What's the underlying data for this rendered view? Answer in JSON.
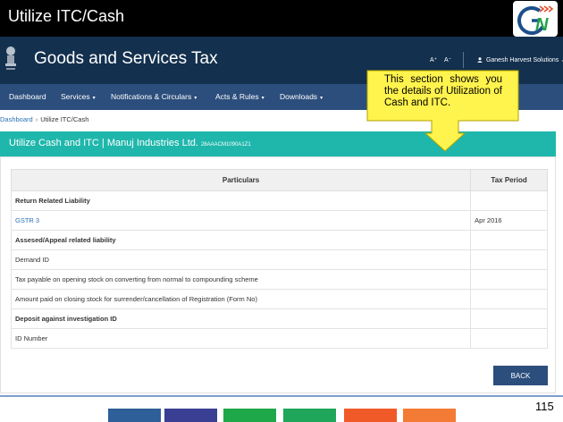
{
  "slide": {
    "title": "Utilize ITC/Cash",
    "logo_text": "GN",
    "page_number": "115"
  },
  "header": {
    "title": "Goods and Services Tax",
    "font_increase": "A⁺",
    "font_decrease": "A⁻",
    "user_name": "Ganesh Harvest Solutions",
    "user_caret": "⌄"
  },
  "nav": {
    "items": [
      {
        "label": "Dashboard",
        "has_caret": false
      },
      {
        "label": "Services",
        "has_caret": true
      },
      {
        "label": "Notifications & Circulars",
        "has_caret": true
      },
      {
        "label": "Acts & Rules",
        "has_caret": true
      },
      {
        "label": "Downloads",
        "has_caret": true
      }
    ],
    "caret_glyph": "▾"
  },
  "breadcrumb": {
    "home": "Dashboard",
    "separator": "›",
    "current": "Utilize ITC/Cash"
  },
  "section": {
    "title": "Utilize Cash and ITC | Manuj Industries Ltd.",
    "gstin": "28AAACM1090A1Z1"
  },
  "table": {
    "headers": [
      "Particulars",
      "Tax Period"
    ],
    "rows": [
      {
        "particular": "Return Related Liability",
        "period": "",
        "bold": true,
        "link": false
      },
      {
        "particular": "GSTR 3",
        "period": "Apr 2016",
        "bold": false,
        "link": true
      },
      {
        "particular": "Assesed/Appeal related liability",
        "period": "",
        "bold": true,
        "link": false
      },
      {
        "particular": "Demand ID",
        "period": "",
        "bold": false,
        "link": false
      },
      {
        "particular": "Tax payable on opening stock on converting from normal to compounding scheme",
        "period": "",
        "bold": false,
        "link": false
      },
      {
        "particular": "Amount paid on closing stock for surrender/cancellation of Registration (Form No)",
        "period": "",
        "bold": false,
        "link": false
      },
      {
        "particular": "Deposit against investigation ID",
        "period": "",
        "bold": true,
        "link": false
      },
      {
        "particular": "ID Number",
        "period": "",
        "bold": false,
        "link": false
      }
    ]
  },
  "actions": {
    "back_label": "BACK"
  },
  "callout": {
    "text": "This section shows you the details of Utilization of Cash and ITC."
  },
  "colors": {
    "header_bg": "#13304e",
    "nav_bg": "#2c4e7c",
    "section_teal": "#1fb7ab",
    "callout_fill": "#fff34d",
    "link": "#2a72b5",
    "bottom_blocks": [
      "#2e5f98",
      "#3a3f93",
      "#1ea84a",
      "#1fa65a",
      "#f05a28",
      "#f37b35"
    ]
  }
}
